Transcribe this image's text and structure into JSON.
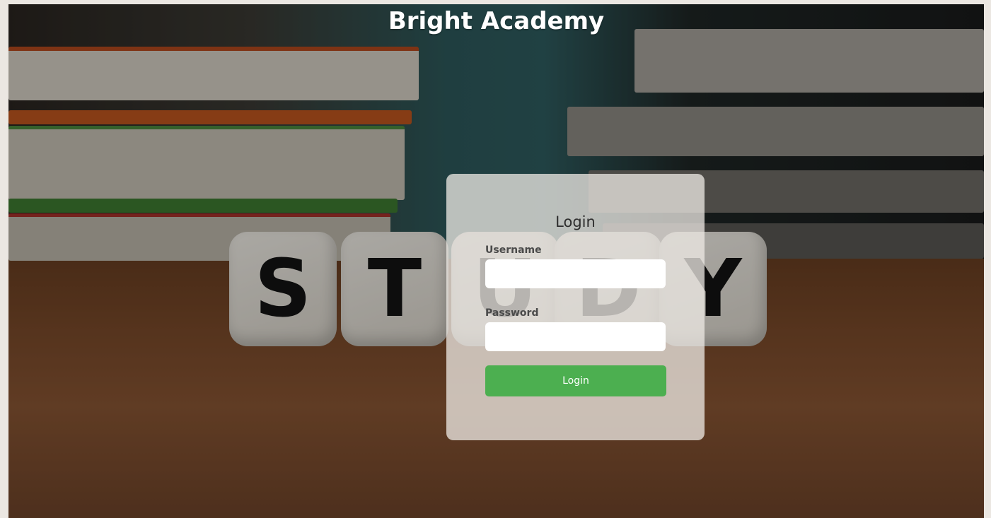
{
  "header": {
    "title": "Bright Academy"
  },
  "background": {
    "description_letters": [
      "S",
      "T",
      "U",
      "D",
      "Y"
    ]
  },
  "login_form": {
    "title": "Login",
    "username": {
      "label": "Username",
      "value": "",
      "placeholder": ""
    },
    "password": {
      "label": "Password",
      "value": "",
      "placeholder": ""
    },
    "submit_label": "Login"
  },
  "colors": {
    "accent": "#4caf50",
    "card_background": "#ece8e4",
    "title_text": "#ffffff"
  }
}
